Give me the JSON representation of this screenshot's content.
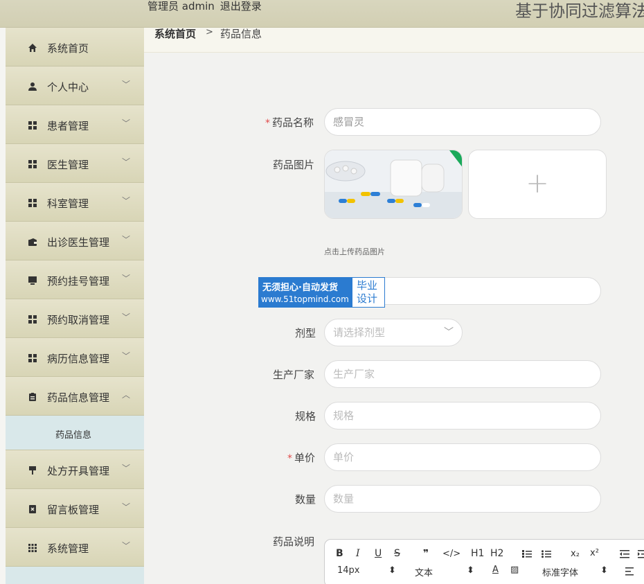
{
  "header": {
    "user_label": "管理员 admin",
    "logout": "退出登录",
    "system_title": "基于协同过滤算法"
  },
  "sidebar": {
    "items": [
      {
        "label": "系统首页",
        "icon": "home-icon",
        "expandable": false
      },
      {
        "label": "个人中心",
        "icon": "user-icon",
        "expandable": true
      },
      {
        "label": "患者管理",
        "icon": "grid-icon",
        "expandable": true
      },
      {
        "label": "医生管理",
        "icon": "grid-icon",
        "expandable": true
      },
      {
        "label": "科室管理",
        "icon": "grid-icon",
        "expandable": true
      },
      {
        "label": "出诊医生管理",
        "icon": "wallet-icon",
        "expandable": true
      },
      {
        "label": "预约挂号管理",
        "icon": "monitor-icon",
        "expandable": true
      },
      {
        "label": "预约取消管理",
        "icon": "grid-icon",
        "expandable": true
      },
      {
        "label": "病历信息管理",
        "icon": "grid-icon",
        "expandable": true
      },
      {
        "label": "药品信息管理",
        "icon": "clipboard-icon",
        "expandable": true,
        "expanded": true
      },
      {
        "label": "处方开具管理",
        "icon": "brush-icon",
        "expandable": true
      },
      {
        "label": "留言板管理",
        "icon": "note-icon",
        "expandable": true
      },
      {
        "label": "系统管理",
        "icon": "apps-icon",
        "expandable": true
      }
    ],
    "submenu_active": "药品信息",
    "arrow_down": "﹀",
    "arrow_up": "︿"
  },
  "breadcrumb": {
    "home": "系统首页",
    "separator": ">",
    "current": "药品信息"
  },
  "form": {
    "name_label": "药品名称",
    "name_value": "感冒灵",
    "image_label": "药品图片",
    "upload_hint": "点击上传药品图片",
    "dosage_label": "剂型",
    "dosage_placeholder": "请选择剂型",
    "manufacturer_label": "生产厂家",
    "manufacturer_placeholder": "生产厂家",
    "spec_label": "规格",
    "spec_placeholder": "规格",
    "price_label": "单价",
    "price_placeholder": "单价",
    "qty_label": "数量",
    "qty_placeholder": "数量",
    "desc_label": "药品说明",
    "required_mark": "*"
  },
  "watermark": {
    "line1": "无须担心·自动发货",
    "line2": "www.51topmind.com",
    "right1": "毕业",
    "right2": "设计"
  },
  "editor": {
    "buttons": [
      "B",
      "I",
      "U",
      "S",
      "❞",
      "</>",
      "H1",
      "H2"
    ],
    "font_size": "14px",
    "text_type": "文本",
    "font_family": "标准字体"
  },
  "colors": {
    "header_bg": "#d6d3b8",
    "sidebar_item_bg": "#dedbc1",
    "submenu_bg": "#d9e8ea",
    "required": "#e04b4b",
    "watermark_blue": "#2b7bd0"
  }
}
